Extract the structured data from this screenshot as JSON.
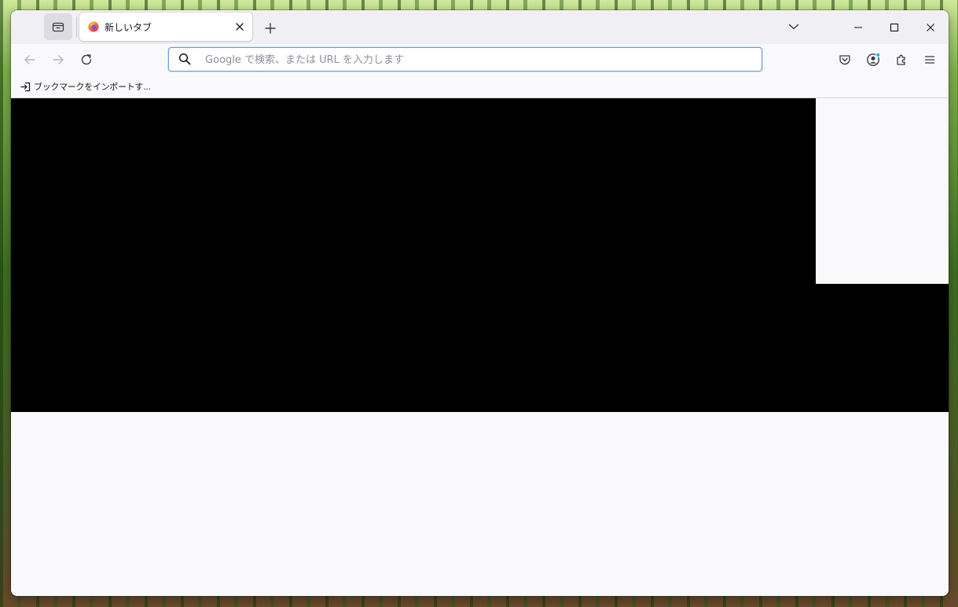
{
  "tabbar": {
    "tab_title": "新しいタブ"
  },
  "toolbar": {
    "url_placeholder": "Google で検索、または URL を入力します",
    "url_value": ""
  },
  "bookmarks": {
    "import_label": "ブックマークをインポートす..."
  },
  "colors": {
    "tabbar_bg": "#f0f0f4",
    "toolbar_bg": "#f9f9fb",
    "urlbar_focus_border": "#6c9fd4",
    "notification_dot": "#00b3f4",
    "content_block": "#000000"
  },
  "icons": {
    "tab_list": "tab-list-icon",
    "favicon": "firefox-icon",
    "close_tab": "close-icon",
    "new_tab": "plus-icon",
    "list_tabs": "chevron-down-icon",
    "back": "back-arrow-icon",
    "forward": "forward-arrow-icon",
    "reload": "reload-icon",
    "search": "search-icon",
    "pocket": "pocket-icon",
    "account": "account-icon",
    "extensions": "puzzle-icon",
    "menu": "hamburger-menu-icon",
    "import": "import-icon"
  }
}
